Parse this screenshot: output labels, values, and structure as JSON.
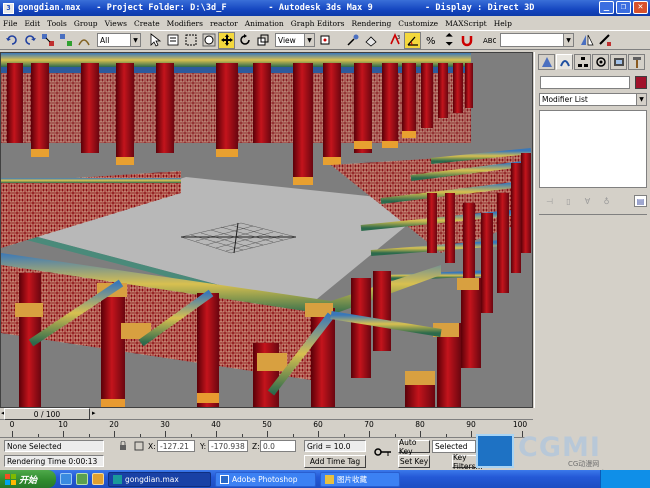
{
  "window": {
    "title": "gongdian.max   - Project Folder: D:\\3d_F        - Autodesk 3ds Max 9          - Display : Direct 3D"
  },
  "menu": [
    "File",
    "Edit",
    "Tools",
    "Group",
    "Views",
    "Create",
    "Modifiers",
    "reactor",
    "Animation",
    "Graph Editors",
    "Rendering",
    "Customize",
    "MAXScript",
    "Help"
  ],
  "toolbar": {
    "selection_filter": "All",
    "ref_coord": "View",
    "named_selection": ""
  },
  "command_panel": {
    "modifier_list_label": "Modifier List",
    "object_color": "#a0122a"
  },
  "timeline": {
    "frame_display": "0 / 100",
    "ticks": [
      "0",
      "10",
      "20",
      "30",
      "40",
      "50",
      "60",
      "70",
      "80",
      "90",
      "100"
    ]
  },
  "status": {
    "selection": "None Selected",
    "prompt": "Rendering Time  0:00:13",
    "x_label": "X:",
    "x_value": "-127.21",
    "y_label": "Y:",
    "y_value": "-170.938",
    "z_label": "Z:",
    "z_value": "0.0",
    "grid": "Grid = 10.0",
    "add_time_tag": "Add Time Tag",
    "auto_key": "Auto Key",
    "set_key": "Set Key",
    "key_mode": "Selected",
    "key_filters": "Key Filters..."
  },
  "watermark": {
    "text": "CGMI",
    "sub": "CG动漫网 www.cgmi.com"
  },
  "taskbar": {
    "start": "开始",
    "tasks": [
      {
        "label": "gongdian.max",
        "active": true
      },
      {
        "label": "Adobe Photoshop",
        "active": false
      },
      {
        "label": "图片收藏",
        "active": false
      }
    ]
  }
}
